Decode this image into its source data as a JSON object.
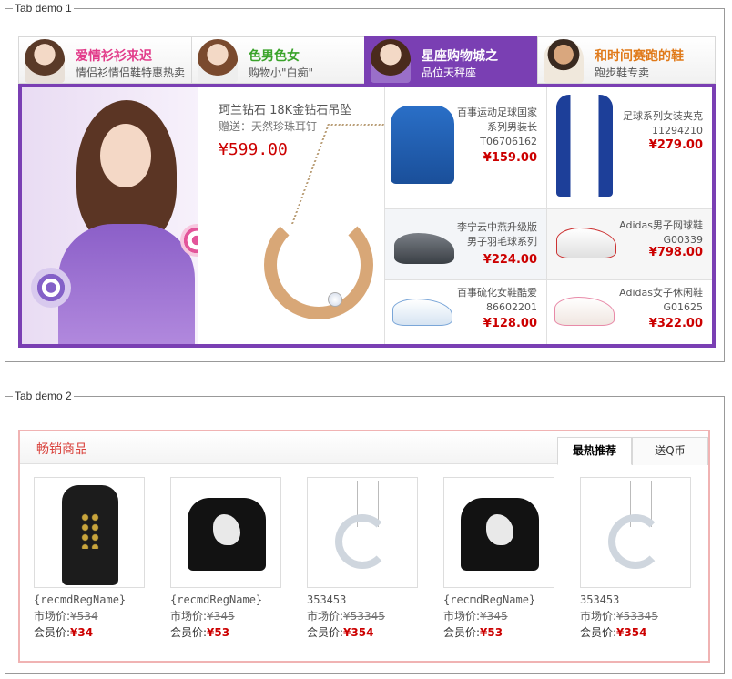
{
  "demo1": {
    "legend": "Tab demo 1",
    "tabs": [
      {
        "title": "爱情衫衫来迟",
        "subtitle": "情侣衫情侣鞋特惠热卖",
        "color": "#e23c8a"
      },
      {
        "title": "色男色女",
        "subtitle": "购物小\"白痴\"",
        "color": "#3aa32a"
      },
      {
        "title": "星座购物城之",
        "subtitle": "品位天秤座",
        "color": "#ffffff"
      },
      {
        "title": "和时间赛跑的鞋",
        "subtitle": "跑步鞋专卖",
        "color": "#e07a1a"
      }
    ],
    "active_tab": 2,
    "feature": {
      "name": "珂兰钻石 18K金钻石吊坠",
      "gift": "赠送：天然珍珠耳钉",
      "price": "¥599.00"
    },
    "products": [
      {
        "name": "百事运动足球国家系列男装长T06706162",
        "price": "¥159.00"
      },
      {
        "name": "足球系列女装夹克11294210",
        "price": "¥279.00"
      },
      {
        "name": "李宁云中燕升级版男子羽毛球系列",
        "price": "¥224.00"
      },
      {
        "name": "Adidas男子网球鞋G00339",
        "price": "¥798.00"
      },
      {
        "name": "百事硫化女鞋酷爱86602201",
        "price": "¥128.00"
      },
      {
        "name": "Adidas女子休闲鞋G01625",
        "price": "¥322.00"
      }
    ],
    "accent": "#7a3fb3"
  },
  "demo2": {
    "legend": "Tab demo 2",
    "title": "畅销商品",
    "tabs": [
      {
        "label": "最热推荐"
      },
      {
        "label": "送Q币"
      }
    ],
    "market_label": "市场价:",
    "member_label": "会员价:",
    "items": [
      {
        "name": "{recmdRegName}",
        "market": "¥534",
        "member": "¥34",
        "icon": "coat"
      },
      {
        "name": "{recmdRegName}",
        "market": "¥345",
        "member": "¥53",
        "icon": "sweater"
      },
      {
        "name": "353453",
        "market": "¥53345",
        "member": "¥354",
        "icon": "necklace"
      },
      {
        "name": "{recmdRegName}",
        "market": "¥345",
        "member": "¥53",
        "icon": "sweater"
      },
      {
        "name": "353453",
        "market": "¥53345",
        "member": "¥354",
        "icon": "necklace"
      }
    ],
    "accent": "#d9403a"
  }
}
